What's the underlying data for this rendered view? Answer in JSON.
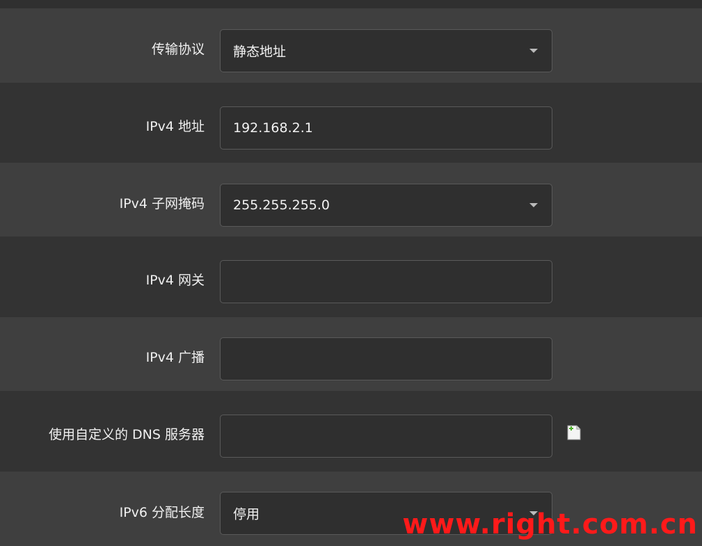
{
  "form": {
    "protocol": {
      "label": "传输协议",
      "value": "静态地址"
    },
    "ipv4_address": {
      "label": "IPv4 地址",
      "value": "192.168.2.1"
    },
    "ipv4_netmask": {
      "label": "IPv4 子网掩码",
      "value": "255.255.255.0"
    },
    "ipv4_gateway": {
      "label": "IPv4 网关",
      "value": ""
    },
    "ipv4_broadcast": {
      "label": "IPv4 广播",
      "value": ""
    },
    "custom_dns": {
      "label": "使用自定义的 DNS 服务器",
      "value": "",
      "add_icon": "add-entry-icon"
    },
    "ipv6_assign": {
      "label": "IPv6 分配长度",
      "value": "停用"
    }
  },
  "watermark": "www.right.com.cn",
  "colors": {
    "row_light": "#3f3f3f",
    "row_dark": "#333333",
    "input_bg": "#2f2f2f",
    "input_border": "#5a5a5a",
    "watermark": "#ff1a1a"
  }
}
